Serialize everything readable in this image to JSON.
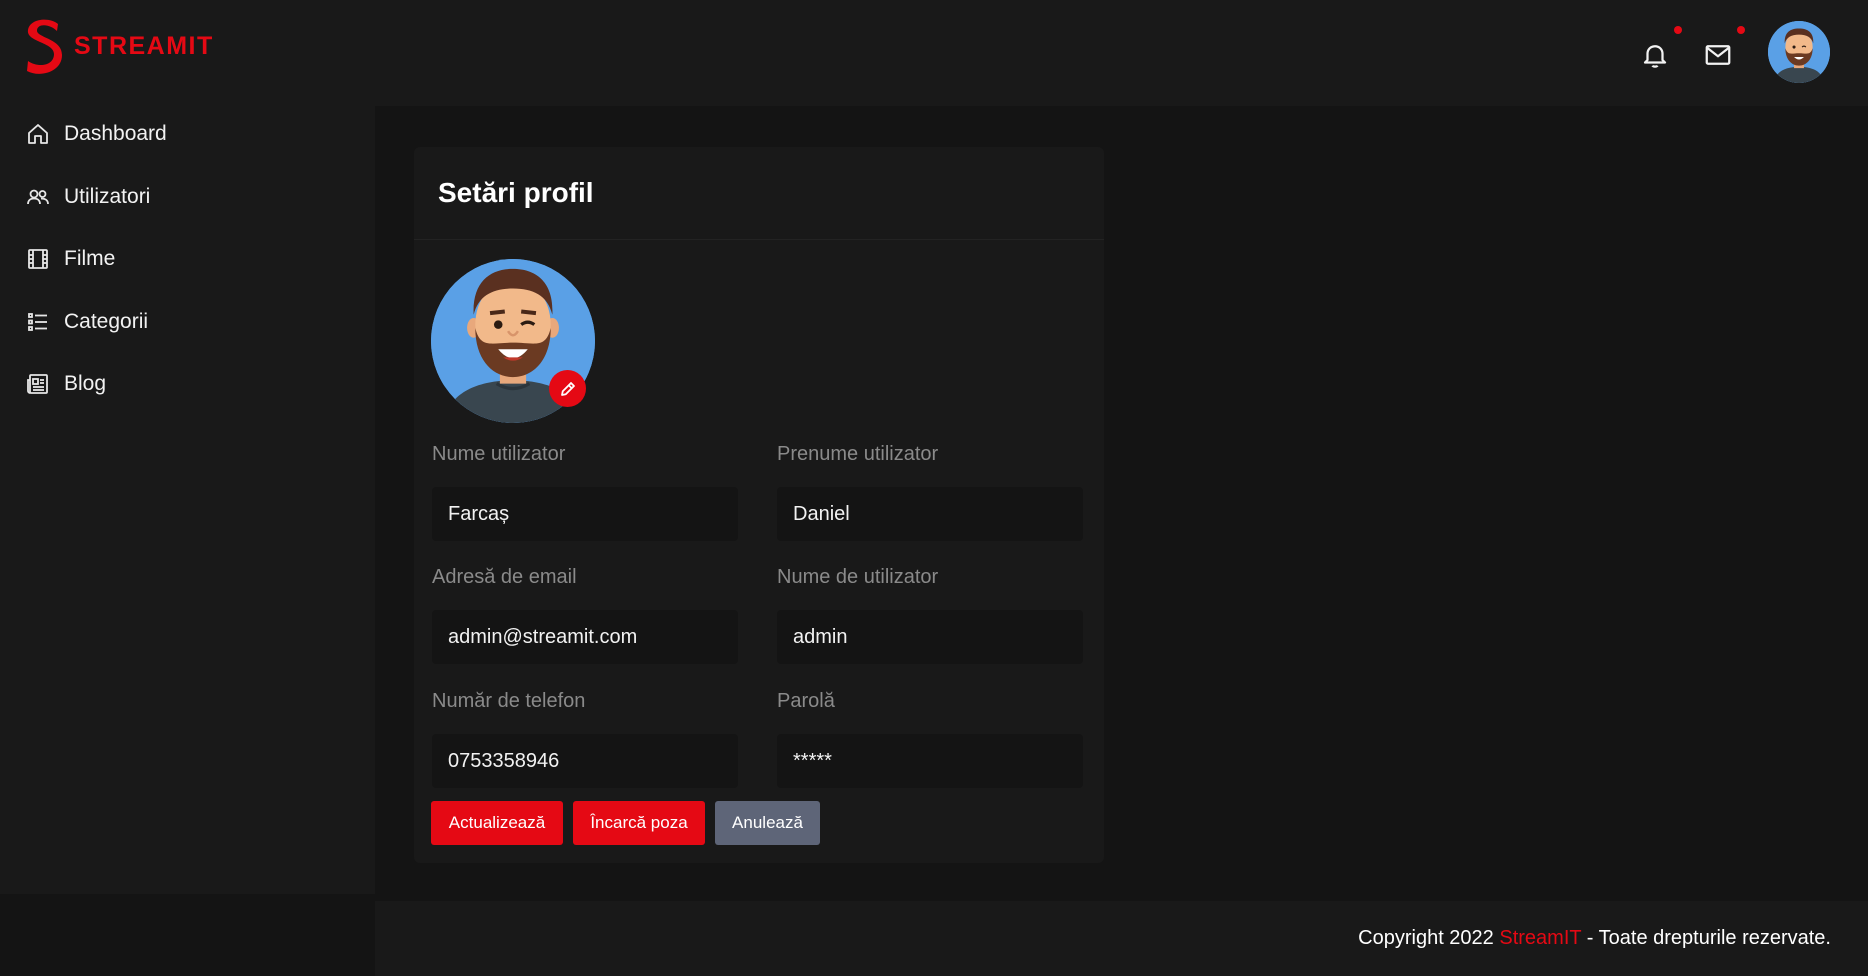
{
  "brand": {
    "name": "STREAMIT",
    "accent_color": "#e50914"
  },
  "sidebar": {
    "items": [
      {
        "label": "Dashboard",
        "icon": "home-icon"
      },
      {
        "label": "Utilizatori",
        "icon": "users-icon"
      },
      {
        "label": "Filme",
        "icon": "film-icon"
      },
      {
        "label": "Categorii",
        "icon": "list-icon"
      },
      {
        "label": "Blog",
        "icon": "newspaper-icon"
      }
    ]
  },
  "header": {
    "icons": [
      "bell-icon",
      "mail-icon"
    ],
    "has_notifications": true,
    "has_messages": true
  },
  "profile": {
    "title": "Setări profil",
    "fields": [
      {
        "label": "Nume utilizator",
        "value": "Farcaș"
      },
      {
        "label": "Prenume utilizator",
        "value": "Daniel"
      },
      {
        "label": "Adresă de email",
        "value": "admin@streamit.com"
      },
      {
        "label": "Nume de utilizator",
        "value": "admin"
      },
      {
        "label": "Număr de telefon",
        "value": "0753358946"
      },
      {
        "label": "Parolă",
        "value": "*****"
      }
    ],
    "buttons": {
      "update": "Actualizează",
      "upload": "Încarcă poza",
      "cancel": "Anulează"
    },
    "button_colors": {
      "primary": "#e50914",
      "secondary": "#5e6578"
    }
  },
  "footer": {
    "prefix": "Copyright 2022 ",
    "brand": "StreamIT",
    "suffix": " - Toate drepturile rezervate."
  }
}
